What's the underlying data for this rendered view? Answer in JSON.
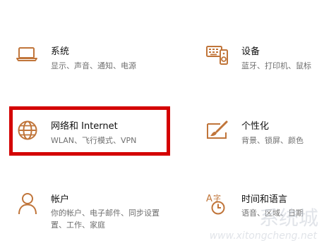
{
  "settings": {
    "system": {
      "title": "系统",
      "description": "显示、声音、通知、电源",
      "icon": "laptop-icon"
    },
    "devices": {
      "title": "设备",
      "description": "蓝牙、打印机、鼠标",
      "icon": "keyboard-speaker-icon"
    },
    "network": {
      "title": "网络和 Internet",
      "description": "WLAN、飞行模式、VPN",
      "icon": "globe-icon"
    },
    "personalization": {
      "title": "个性化",
      "description": "背景、锁屏、颜色",
      "icon": "paint-brush-icon"
    },
    "accounts": {
      "title": "帐户",
      "description_line1": "你的帐户、电子邮件、同步设置",
      "description_line2": "置、工作、家庭",
      "icon": "person-icon"
    },
    "time_language": {
      "title": "时间和语言",
      "description": "语音、区域、日期",
      "icon": "time-language-icon"
    }
  },
  "watermark": {
    "text": "系统城",
    "url": "www.xitongcheng.net"
  },
  "colors": {
    "icon": "#c0753a",
    "highlight": "#d40000",
    "title": "#111111",
    "description": "#6f6f6f"
  }
}
